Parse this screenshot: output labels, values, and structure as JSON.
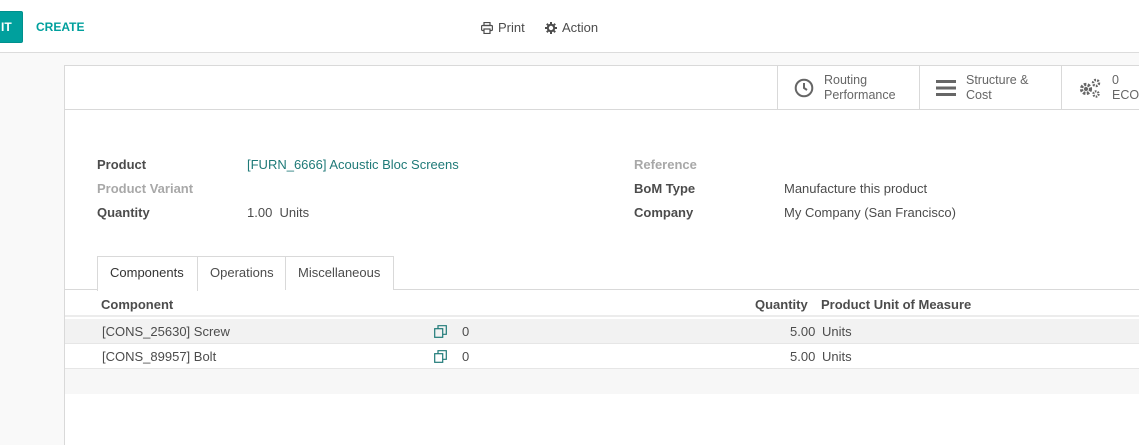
{
  "control_panel": {
    "edit_label": "IT",
    "create_label": "CREATE",
    "print_label": "Print",
    "action_label": "Action"
  },
  "smart_buttons": {
    "routing_line1": "Routing",
    "routing_line2": "Performance",
    "structure_line1": "Structure &",
    "structure_line2": "Cost",
    "eco_count": "0",
    "eco_label": "ECO(s"
  },
  "form": {
    "product_label": "Product",
    "product_value": "[FURN_6666] Acoustic Bloc Screens",
    "variant_label": "Product Variant",
    "quantity_label": "Quantity",
    "quantity_value": "1.00",
    "quantity_uom": "Units",
    "reference_label": "Reference",
    "bom_type_label": "BoM Type",
    "bom_type_value": "Manufacture this product",
    "company_label": "Company",
    "company_value": "My Company (San Francisco)"
  },
  "tabs": [
    {
      "label": "Components"
    },
    {
      "label": "Operations"
    },
    {
      "label": "Miscellaneous"
    }
  ],
  "components_table": {
    "headers": {
      "component": "Component",
      "quantity": "Quantity",
      "uom": "Product Unit of Measure"
    },
    "rows": [
      {
        "component": "[CONS_25630] Screw",
        "copies": "0",
        "quantity": "5.00",
        "uom": "Units"
      },
      {
        "component": "[CONS_89957] Bolt",
        "copies": "0",
        "quantity": "5.00",
        "uom": "Units"
      }
    ]
  },
  "colors": {
    "accent": "#00a09d",
    "link": "#1f7a78"
  }
}
